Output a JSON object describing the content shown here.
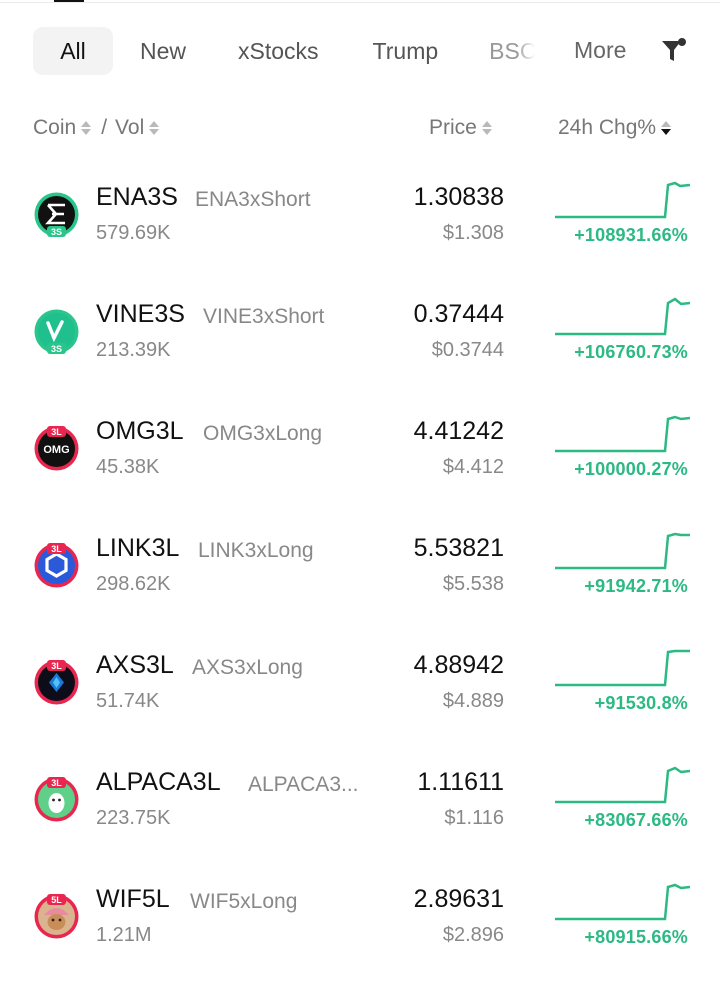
{
  "tabs": [
    {
      "label": "All"
    },
    {
      "label": "New"
    },
    {
      "label": "xStocks"
    },
    {
      "label": "Trump"
    },
    {
      "label": "BSC"
    }
  ],
  "more_label": "More",
  "header": {
    "coin": "Coin",
    "separator": "/",
    "vol": "Vol",
    "price": "Price",
    "change": "24h Chg%"
  },
  "rows": [
    {
      "symbol": "ENA3S",
      "full_name": "ENA3xShort",
      "volume": "579.69K",
      "price": "1.30838",
      "fiat": "$1.308",
      "change": "+108931.66%",
      "badge": "3S"
    },
    {
      "symbol": "VINE3S",
      "full_name": "VINE3xShort",
      "volume": "213.39K",
      "price": "0.37444",
      "fiat": "$0.3744",
      "change": "+106760.73%",
      "badge": "3S"
    },
    {
      "symbol": "OMG3L",
      "full_name": "OMG3xLong",
      "volume": "45.38K",
      "price": "4.41242",
      "fiat": "$4.412",
      "change": "+100000.27%",
      "badge": "3L",
      "logo_text": "OMG"
    },
    {
      "symbol": "LINK3L",
      "full_name": "LINK3xLong",
      "volume": "298.62K",
      "price": "5.53821",
      "fiat": "$5.538",
      "change": "+91942.71%",
      "badge": "3L"
    },
    {
      "symbol": "AXS3L",
      "full_name": "AXS3xLong",
      "volume": "51.74K",
      "price": "4.88942",
      "fiat": "$4.889",
      "change": "+91530.8%",
      "badge": "3L"
    },
    {
      "symbol": "ALPACA3L",
      "full_name": "ALPACA3...",
      "volume": "223.75K",
      "price": "1.11611",
      "fiat": "$1.116",
      "change": "+83067.66%",
      "badge": "3L"
    },
    {
      "symbol": "WIF5L",
      "full_name": "WIF5xLong",
      "volume": "1.21M",
      "price": "2.89631",
      "fiat": "$2.896",
      "change": "+80915.66%",
      "badge": "5L"
    }
  ],
  "colors": {
    "positive": "#2cb983",
    "short_badge": "#29c58a",
    "long_badge": "#e8264f"
  },
  "icons": [
    "filter-icon",
    "sort-icon"
  ]
}
